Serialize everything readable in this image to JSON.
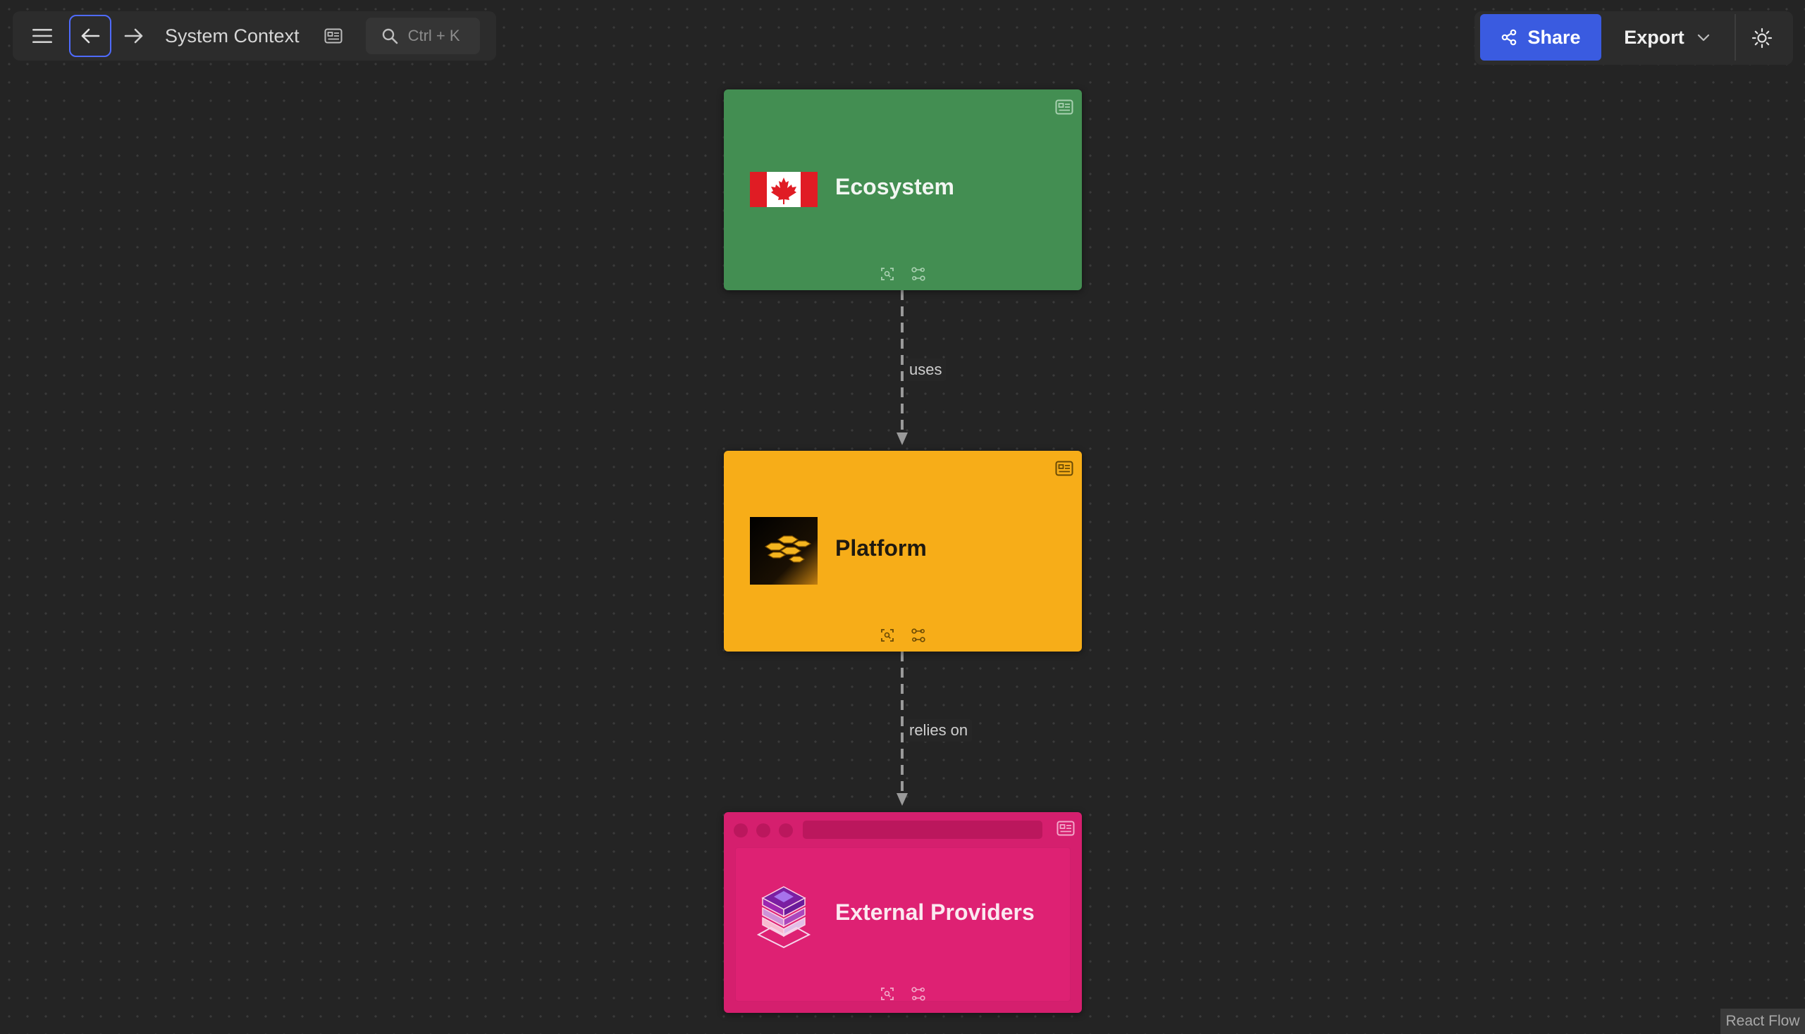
{
  "toolbar": {
    "title": "System Context",
    "search_shortcut": "Ctrl + K",
    "share_label": "Share",
    "export_label": "Export"
  },
  "nodes": [
    {
      "title": "Ecosystem",
      "color": "#438e52",
      "image": "canada-flag"
    },
    {
      "title": "Platform",
      "color": "#f7ad18",
      "image": "gold-hexagons"
    },
    {
      "title": "External Providers",
      "color": "#d51f6e",
      "image": "isometric-stack",
      "shape": "browser"
    }
  ],
  "edges": [
    {
      "from": "Ecosystem",
      "to": "Platform",
      "label": "uses",
      "style": "dashed"
    },
    {
      "from": "Platform",
      "to": "External Providers",
      "label": "relies on",
      "style": "dashed"
    }
  ],
  "attribution": "React Flow",
  "colors": {
    "accent": "#3a5be0",
    "canvas": "#242424"
  }
}
